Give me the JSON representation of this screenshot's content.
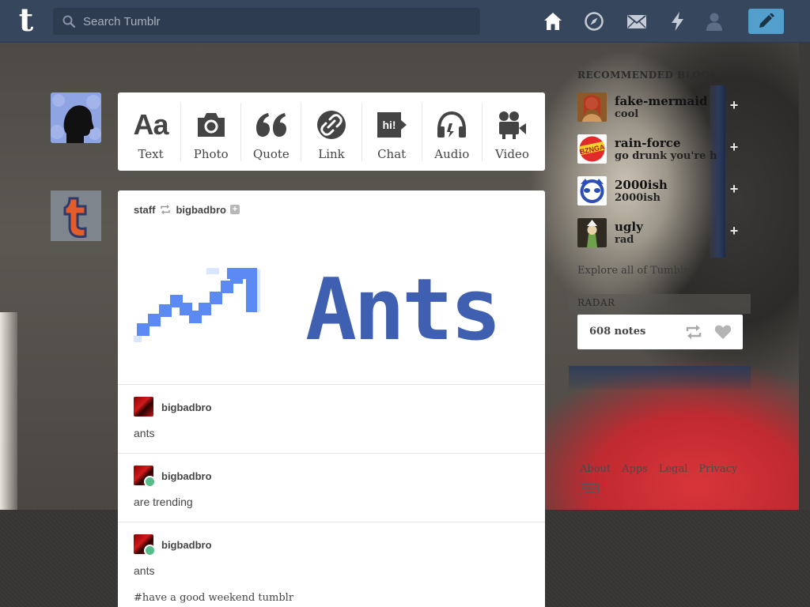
{
  "header": {
    "logo": "t",
    "search_placeholder": "Search Tumblr",
    "nav_icons": [
      "home-icon",
      "compass-icon",
      "mail-icon",
      "lightning-icon",
      "account-icon"
    ],
    "compose_icon": "pencil-icon",
    "bg_color": "#36465d",
    "accent": "#529ecc"
  },
  "post_types": [
    {
      "label": "Text",
      "icon": "text-aa-icon",
      "glyph": "Aa"
    },
    {
      "label": "Photo",
      "icon": "camera-icon"
    },
    {
      "label": "Quote",
      "icon": "quote-icon"
    },
    {
      "label": "Link",
      "icon": "link-icon"
    },
    {
      "label": "Chat",
      "icon": "chat-bubble-icon",
      "glyph": "hi!"
    },
    {
      "label": "Audio",
      "icon": "headphones-icon"
    },
    {
      "label": "Video",
      "icon": "video-camera-icon"
    }
  ],
  "post": {
    "author": "staff",
    "reblogged_from": "bigbadbro",
    "image_text": "Ants",
    "thread": [
      {
        "user": "bigbadbro",
        "text": "ants"
      },
      {
        "user": "bigbadbro",
        "text": "are trending"
      },
      {
        "user": "bigbadbro",
        "text": "ants"
      }
    ],
    "tags": "#have a good weekend tumblr"
  },
  "sidebar": {
    "recommended_title": "RECOMMENDED BLOGS",
    "recommended": [
      {
        "name": "fake-mermaid",
        "title": "cool"
      },
      {
        "name": "rain-force",
        "title": "go drunk you're h"
      },
      {
        "name": "2000ish",
        "title": "2000ish"
      },
      {
        "name": "ugly",
        "title": "rad"
      }
    ],
    "follow_glyph": "+",
    "explore": "Explore all of Tumblr",
    "radar_title": "RADAR",
    "radar_notes": "608 notes",
    "footer_links": [
      "About",
      "Apps",
      "Legal",
      "Privacy"
    ]
  }
}
